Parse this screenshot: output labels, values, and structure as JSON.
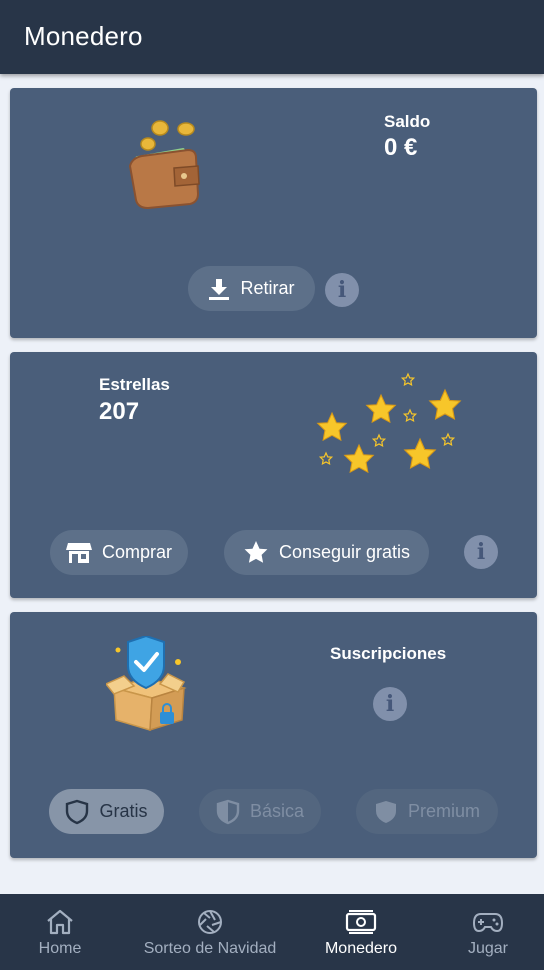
{
  "header": {
    "title": "Monedero"
  },
  "wallet": {
    "balance_label": "Saldo",
    "balance_value": "0 €",
    "withdraw_label": "Retirar"
  },
  "stars": {
    "label": "Estrellas",
    "count": "207",
    "buy_label": "Comprar",
    "free_label": "Conseguir gratis"
  },
  "subscriptions": {
    "label": "Suscripciones",
    "tiers": [
      {
        "label": "Gratis",
        "active": true
      },
      {
        "label": "Básica",
        "active": false
      },
      {
        "label": "Premium",
        "active": false
      }
    ]
  },
  "info_glyph": "i",
  "bottom_nav": [
    {
      "label": "Home",
      "icon": "home-icon",
      "active": false
    },
    {
      "label": "Sorteo de Navidad",
      "icon": "aperture-icon",
      "active": false
    },
    {
      "label": "Monedero",
      "icon": "banknote-icon",
      "active": true
    },
    {
      "label": "Jugar",
      "icon": "gamepad-icon",
      "active": false
    }
  ],
  "colors": {
    "header_bg": "#283548",
    "card_bg": "#4a5e7a",
    "page_bg": "#edf1f8",
    "star_yellow": "#f7c62a"
  }
}
